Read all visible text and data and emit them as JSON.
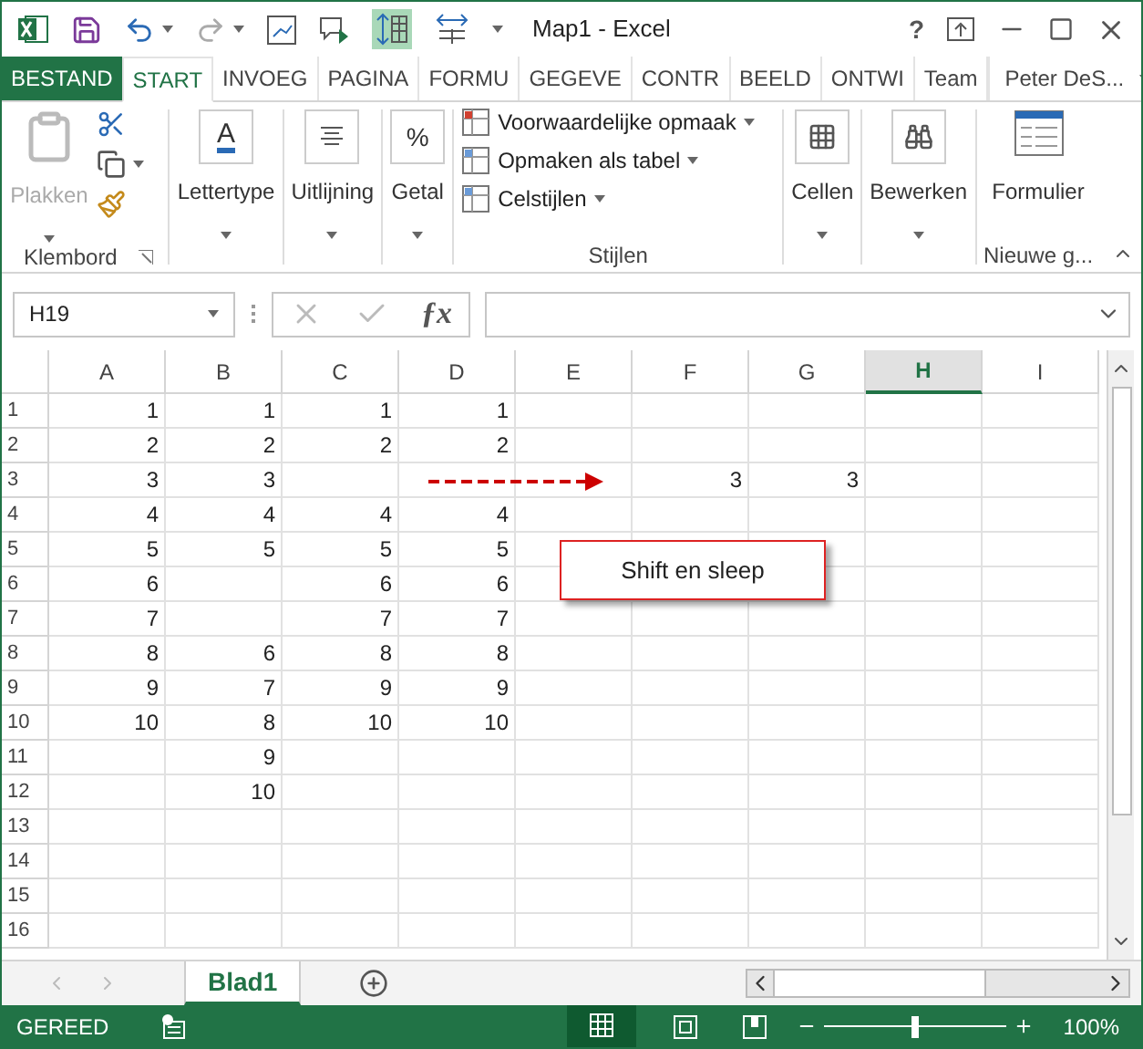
{
  "window": {
    "title": "Map1 - Excel",
    "help": "?"
  },
  "tabs": [
    {
      "label": "BESTAND",
      "kind": "file",
      "selected": false
    },
    {
      "label": "START",
      "kind": "tab",
      "selected": true
    },
    {
      "label": "INVOEG",
      "kind": "tab",
      "selected": false
    },
    {
      "label": "PAGINA",
      "kind": "tab",
      "selected": false
    },
    {
      "label": "FORMU",
      "kind": "tab",
      "selected": false
    },
    {
      "label": "GEGEVE",
      "kind": "tab",
      "selected": false
    },
    {
      "label": "CONTR",
      "kind": "tab",
      "selected": false
    },
    {
      "label": "BEELD",
      "kind": "tab",
      "selected": false
    },
    {
      "label": "ONTWI",
      "kind": "tab",
      "selected": false
    },
    {
      "label": "Team",
      "kind": "tab",
      "selected": false
    }
  ],
  "user": "Peter DeS...",
  "ribbon": {
    "font_icon": "A",
    "number_icon": "%",
    "paste": "Plakken",
    "clipboard": "Klembord",
    "font": "Lettertype",
    "align": "Uitlijning",
    "number": "Getal",
    "styles": [
      "Voorwaardelijke opmaak",
      "Opmaken als tabel",
      "Celstijlen"
    ],
    "styles_group": "Stijlen",
    "cells": "Cellen",
    "edit": "Bewerken",
    "form": "Formulier",
    "new_group": "Nieuwe g..."
  },
  "name_box": "H19",
  "function_icon": "ƒx",
  "columns": [
    {
      "label": "A",
      "selected": false
    },
    {
      "label": "B",
      "selected": false
    },
    {
      "label": "C",
      "selected": false
    },
    {
      "label": "D",
      "selected": false
    },
    {
      "label": "E",
      "selected": false
    },
    {
      "label": "F",
      "selected": false
    },
    {
      "label": "G",
      "selected": false
    },
    {
      "label": "H",
      "selected": true
    },
    {
      "label": "I",
      "selected": false
    }
  ],
  "rows": [
    {
      "number": "1",
      "cells": [
        "1",
        "1",
        "1",
        "1",
        null,
        null,
        null,
        null,
        null
      ]
    },
    {
      "number": "2",
      "cells": [
        "2",
        "2",
        "2",
        "2",
        null,
        null,
        null,
        null,
        null
      ]
    },
    {
      "number": "3",
      "cells": [
        "3",
        "3",
        null,
        null,
        null,
        "3",
        "3",
        null,
        null
      ]
    },
    {
      "number": "4",
      "cells": [
        "4",
        "4",
        "4",
        "4",
        null,
        null,
        null,
        null,
        null
      ]
    },
    {
      "number": "5",
      "cells": [
        "5",
        "5",
        "5",
        "5",
        null,
        null,
        null,
        null,
        null
      ]
    },
    {
      "number": "6",
      "cells": [
        "6",
        null,
        "6",
        "6",
        null,
        null,
        null,
        null,
        null
      ]
    },
    {
      "number": "7",
      "cells": [
        "7",
        null,
        "7",
        "7",
        null,
        null,
        null,
        null,
        null
      ]
    },
    {
      "number": "8",
      "cells": [
        "8",
        "6",
        "8",
        "8",
        null,
        null,
        null,
        null,
        null
      ]
    },
    {
      "number": "9",
      "cells": [
        "9",
        "7",
        "9",
        "9",
        null,
        null,
        null,
        null,
        null
      ]
    },
    {
      "number": "10",
      "cells": [
        "10",
        "8",
        "10",
        "10",
        null,
        null,
        null,
        null,
        null
      ]
    },
    {
      "number": "11",
      "cells": [
        null,
        "9",
        null,
        null,
        null,
        null,
        null,
        null,
        null
      ]
    },
    {
      "number": "12",
      "cells": [
        null,
        "10",
        null,
        null,
        null,
        null,
        null,
        null,
        null
      ]
    },
    {
      "number": "13",
      "cells": [
        null,
        null,
        null,
        null,
        null,
        null,
        null,
        null,
        null
      ]
    },
    {
      "number": "14",
      "cells": [
        null,
        null,
        null,
        null,
        null,
        null,
        null,
        null,
        null
      ]
    },
    {
      "number": "15",
      "cells": [
        null,
        null,
        null,
        null,
        null,
        null,
        null,
        null,
        null
      ]
    },
    {
      "number": "16",
      "cells": [
        null,
        null,
        null,
        null,
        null,
        null,
        null,
        null,
        null
      ]
    }
  ],
  "callout": "Shift en sleep",
  "sheets": [
    {
      "label": "Blad1",
      "selected": true
    }
  ],
  "status": {
    "text": "GEREED",
    "zoom": {
      "level": 0.5
    },
    "zoom_text": "100%"
  }
}
